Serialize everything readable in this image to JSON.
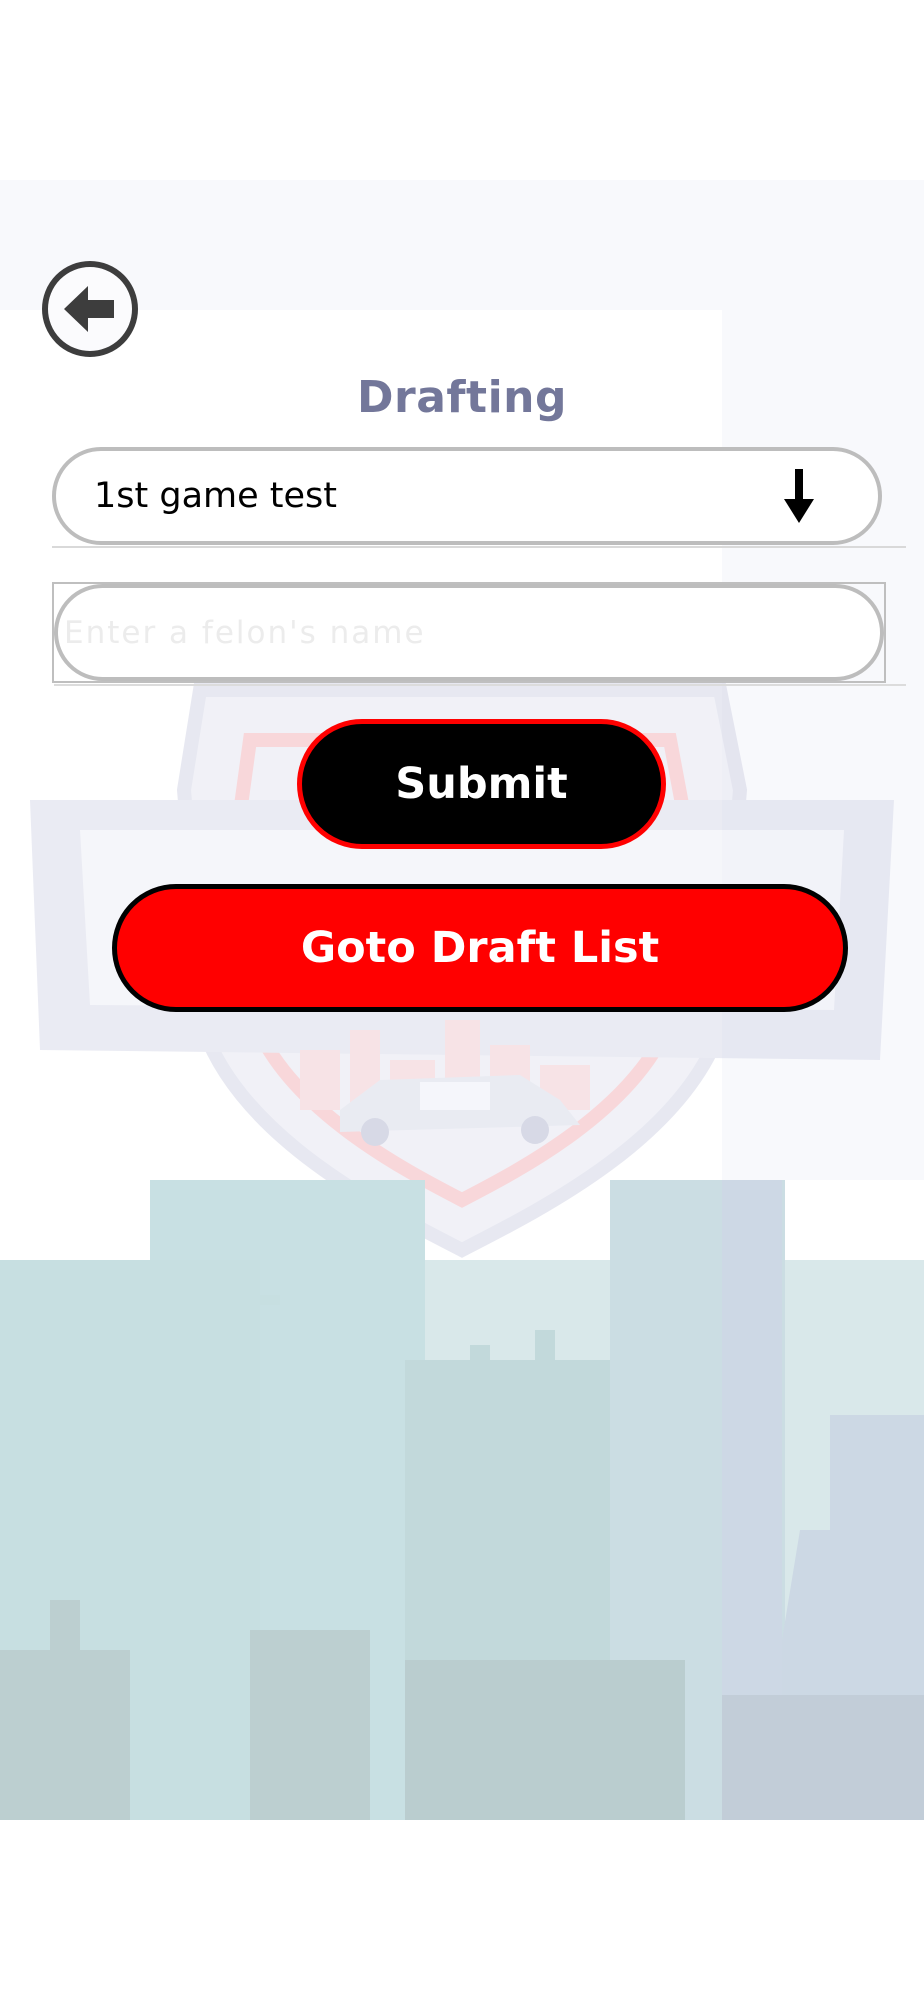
{
  "header": {
    "back_icon": "arrow-left-circle-icon",
    "title": "Drafting"
  },
  "game_select": {
    "selected_value": "1st game test",
    "icon": "arrow-down-icon"
  },
  "felon_input": {
    "placeholder": "Enter a felon's name",
    "value": ""
  },
  "buttons": {
    "submit_label": "Submit",
    "draft_list_label": "Goto Draft List"
  },
  "colors": {
    "title": "#73779a",
    "submit_bg": "#000000",
    "submit_border": "#ff0000",
    "draft_list_bg": "#ff0000",
    "draft_list_border": "#000000"
  }
}
